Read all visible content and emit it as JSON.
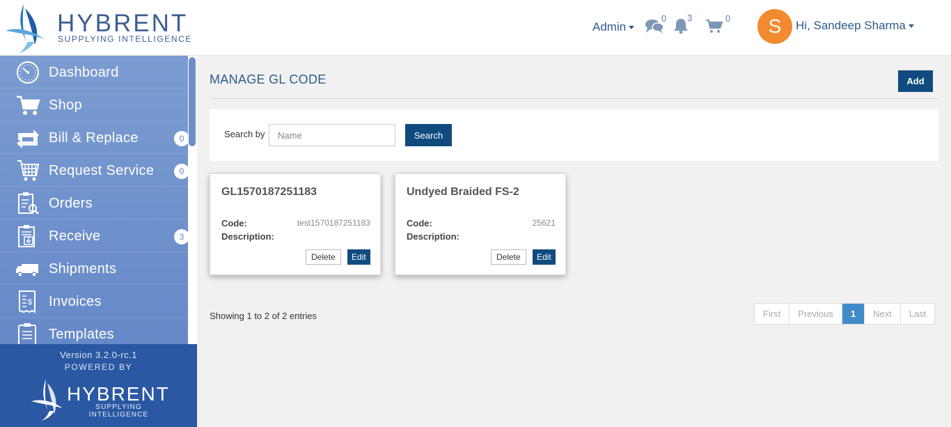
{
  "header": {
    "logo_word": "HYBRENT",
    "logo_tagline": "SUPPLYING INTELLIGENCE",
    "admin_label": "Admin",
    "messages_count": "0",
    "notifications_count": "3",
    "cart_count": "0",
    "avatar_initial": "S",
    "greeting": "Hi, Sandeep Sharma"
  },
  "sidebar": {
    "items": [
      {
        "label": "Dashboard",
        "icon": "dashboard-icon",
        "badge": ""
      },
      {
        "label": "Shop",
        "icon": "cart-icon",
        "badge": ""
      },
      {
        "label": "Bill & Replace",
        "icon": "bill-replace-icon",
        "badge": "0"
      },
      {
        "label": "Request Service",
        "icon": "request-service-icon",
        "badge": "0"
      },
      {
        "label": "Orders",
        "icon": "orders-icon",
        "badge": ""
      },
      {
        "label": "Receive",
        "icon": "receive-icon",
        "badge": "3"
      },
      {
        "label": "Shipments",
        "icon": "truck-icon",
        "badge": ""
      },
      {
        "label": "Invoices",
        "icon": "invoice-icon",
        "badge": ""
      },
      {
        "label": "Templates",
        "icon": "templates-icon",
        "badge": ""
      }
    ],
    "version": "Version 3.2.0-rc.1",
    "powered_by": "POWERED BY",
    "footer_logo_word": "HYBRENT",
    "footer_logo_tagline": "SUPPLYING INTELLIGENCE"
  },
  "main": {
    "title": "MANAGE GL CODE",
    "add_label": "Add",
    "search": {
      "label": "Search by",
      "placeholder": "Name",
      "button_label": "Search"
    },
    "cards": [
      {
        "title": "GL1570187251183",
        "code_label": "Code:",
        "code_value": "test1570187251183",
        "description_label": "Description:",
        "delete_label": "Delete",
        "edit_label": "Edit"
      },
      {
        "title": "Undyed Braided FS-2",
        "code_label": "Code:",
        "code_value": "25621",
        "description_label": "Description:",
        "delete_label": "Delete",
        "edit_label": "Edit"
      }
    ],
    "entries_text": "Showing 1 to 2 of 2 entries",
    "pagination": {
      "first": "First",
      "previous": "Previous",
      "current": "1",
      "next": "Next",
      "last": "Last"
    }
  },
  "colors": {
    "brand_blue": "#2e5a8c",
    "button_navy": "#0f4b7e",
    "sidebar_blue": "#6c8fcb",
    "sidebar_footer": "#2b58a3",
    "avatar_orange": "#f28a2f",
    "active_page": "#428bca"
  }
}
